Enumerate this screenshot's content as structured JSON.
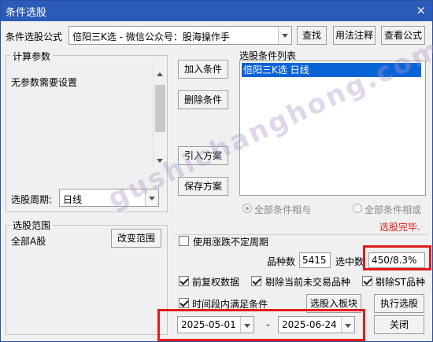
{
  "window": {
    "title": "条件选股",
    "close": "×"
  },
  "formula": {
    "label": "条件选股公式",
    "value": "倍阳三K选  -  微信公众号：股海操作手",
    "find_button": "查找",
    "usage_button": "用法注释",
    "view_button": "查看公式"
  },
  "params": {
    "title": "计算参数",
    "text": "无参数需要设置",
    "period_label": "选股周期:",
    "period_value": "日线"
  },
  "actions": {
    "add": "加入条件",
    "delete": "删除条件",
    "import": "引入方案",
    "save": "保存方案"
  },
  "conditions": {
    "title": "选股条件列表",
    "items": [
      "倍阳三K选  日线"
    ],
    "and_label": "全部条件相与",
    "or_label": "全部条件相或"
  },
  "status": {
    "text": "选股完毕.",
    "color": "#e21b1b"
  },
  "range": {
    "title": "选股范围",
    "value": "全部A股",
    "change_button": "改变范围"
  },
  "options": {
    "variable_period": "使用涨跌不定周期",
    "count_label": "品种数",
    "count_value": "5415",
    "selected_label": "选中数",
    "selected_value": "450/8.3%",
    "adj_label": "前复权数据",
    "exclude_untraded_label": "剔除当前未交易品种",
    "exclude_st_label": "剔除ST品种",
    "time_range_label": "时间段内满足条件",
    "to_block_button": "选股入板块",
    "execute_button": "执行选股",
    "start_date": "2025-05-01",
    "dash": "-",
    "end_date": "2025-06-24",
    "close_button": "关闭"
  },
  "watermark": "gushichanghong.com",
  "accent_color": "#2b5bb8",
  "highlight_color": "#e21b1b",
  "icons": {
    "check": "check-icon",
    "dropdown": "chevron-down-icon",
    "radio": "radio-icon"
  }
}
